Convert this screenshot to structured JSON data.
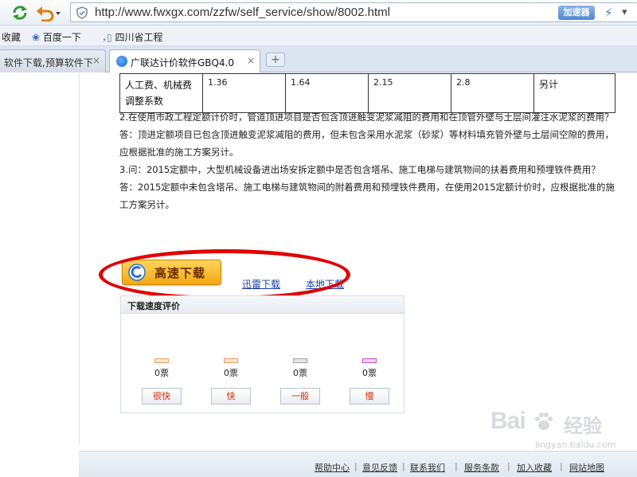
{
  "browser": {
    "url": "http://www.fwxgx.com/zzfw/self_service/show/8002.html",
    "accelerator_label": "加速器",
    "bookmarks": [
      "收藏",
      "百度一下",
      "四川省工程"
    ],
    "bookmark_separator": "，",
    "tabs": [
      {
        "label": "软件下载,预算软件下",
        "active": false
      },
      {
        "label": "广联达计价软件GBQ4.0",
        "active": true
      }
    ],
    "new_tab_label": "+",
    "close_glyph": "×"
  },
  "table": {
    "row_label": "人工费、机械费调整系数",
    "values": [
      "1.36",
      "1.64",
      "2.15",
      "2.8"
    ],
    "note": "另计"
  },
  "article": {
    "q2": "2.在使用市政工程定额计价时，管道顶进项目是否包含顶进触变泥浆减阻的费用和在顶管外壁与土层间灌注水泥浆的费用？",
    "a2": "答：顶进定额项目已包含顶进触变泥浆减阻的费用，但未包含采用水泥浆（砂浆）等材料填充管外壁与土层间空隙的费用，应根据批准的施工方案另计。",
    "q3": "3.问：2015定额中，大型机械设备进出场安拆定额中是否包含塔吊、施工电梯与建筑物间的扶着费用和预埋铁件费用？",
    "a3": "答：2015定额中未包含塔吊、施工电梯与建筑物间的附着费用和预埋铁件费用，在使用2015定额计价时，应根据批准的施工方案另计。"
  },
  "download": {
    "fast_label": "高速下载",
    "xunlei_label": "迅雷下载",
    "local_label": "本地下载"
  },
  "rating": {
    "title": "下载速度评价",
    "options": [
      {
        "votes": "0票",
        "label": "很快",
        "color": "#e8a060"
      },
      {
        "votes": "0票",
        "label": "快",
        "color": "#e8a060"
      },
      {
        "votes": "0票",
        "label": "一般",
        "color": "#a0a0a0"
      },
      {
        "votes": "0票",
        "label": "慢",
        "color": "#c050c0"
      }
    ]
  },
  "footer": {
    "links": [
      "帮助中心",
      "意见反馈",
      "联系我们",
      "服务条款",
      "加入收藏",
      "网站地图"
    ],
    "separator": "|"
  },
  "watermark": {
    "brand": "Bai",
    "suffix": "经验",
    "url": "jingyan.baidu.com"
  },
  "colors": {
    "highlight_oval": "#e00000",
    "link": "#1a3ea8",
    "download_button": "#f3a712"
  }
}
